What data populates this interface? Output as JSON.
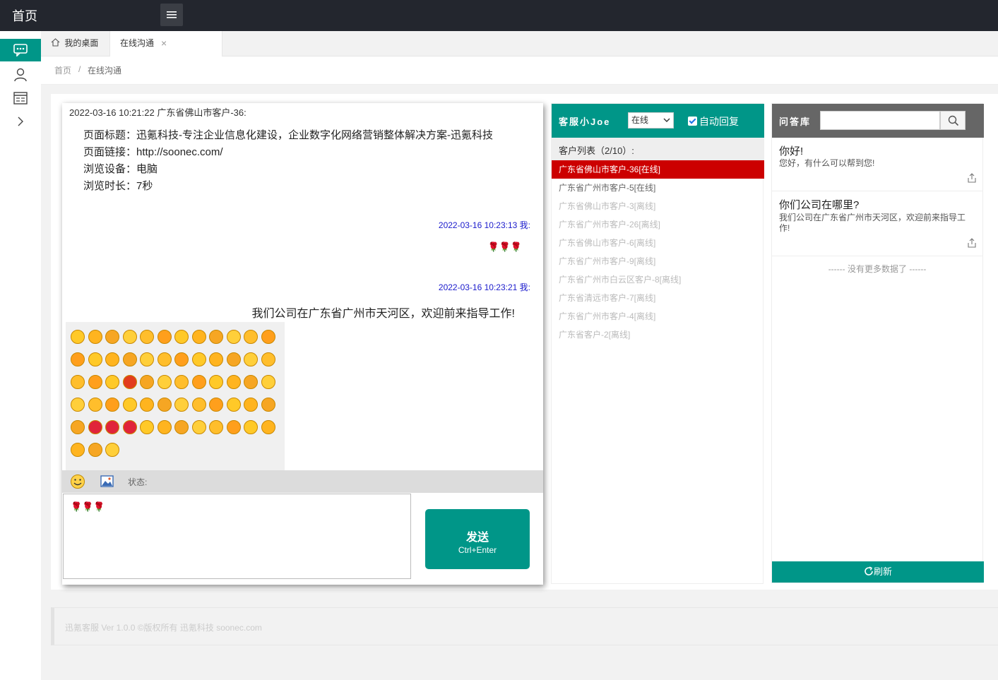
{
  "topbar": {
    "title": "首页"
  },
  "tabs": {
    "desktop": "我的桌面",
    "chat": "在线沟通",
    "close": "×"
  },
  "breadcrumb": {
    "home": "首页",
    "sep": "/",
    "current": "在线沟通"
  },
  "chat": {
    "visitor_head": "2022-03-16 10:21:22 广东省佛山市客户-36:",
    "info": {
      "title": "页面标题：迅氪科技-专注企业信息化建设，企业数字化网络营销整体解决方案-迅氪科技",
      "link": "页面链接：http://soonec.com/",
      "device": "浏览设备：电脑",
      "duration": "浏览时长：7秒"
    },
    "messages": [
      {
        "head": "2022-03-16 10:23:13 我:",
        "body": "🌹🌹🌹"
      },
      {
        "head": "2022-03-16 10:23:21 我:",
        "body": "我们公司在广东省广州市天河区，欢迎前来指导工作!"
      }
    ],
    "status_label": "状态:",
    "input_value": "🌹🌹🌹",
    "send_label": "发送",
    "send_hint": "Ctrl+Enter"
  },
  "cs": {
    "agent": "客服小Joe",
    "status_selected": "在线",
    "auto_reply": "自动回复",
    "list_title": "客户列表（2/10）:",
    "customers": [
      "广东省佛山市客户-36[在线]",
      "广东省广州市客户-5[在线]",
      "广东省佛山市客户-3[离线]",
      "广东省广州市客户-26[离线]",
      "广东省佛山市客户-6[离线]",
      "广东省广州市客户-9[离线]",
      "广东省广州市白云区客户-8[离线]",
      "广东省清远市客户-7[离线]",
      "广东省广州市客户-4[离线]",
      "广东省客户-2[离线]"
    ]
  },
  "qa": {
    "title": "问答库",
    "search_placeholder": "",
    "items": [
      {
        "q": "你好!",
        "a": "您好，有什么可以帮到您!"
      },
      {
        "q": "你们公司在哪里?",
        "a": "我们公司在广东省广州市天河区，欢迎前来指导工作!"
      }
    ],
    "no_more": "------ 没有更多数据了 ------",
    "refresh": "刷新"
  },
  "footer": {
    "text": "迅氪客服 Ver 1.0.0 ©版权所有 迅氪科技 soonec.com"
  },
  "colors": {
    "accent": "#009688",
    "active_customer": "#cc0000",
    "topbar": "#23262e"
  }
}
